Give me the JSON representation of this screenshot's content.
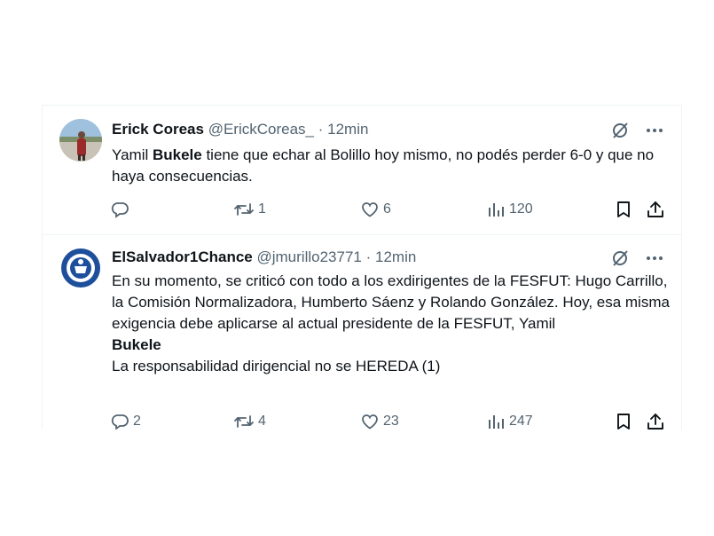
{
  "tweets": [
    {
      "author_name": "Erick Coreas",
      "handle": "@ErickCoreas_",
      "separator": "·",
      "time": "12min",
      "text_parts": [
        "Yamil ",
        "Bukele",
        " tiene que echar al Bolillo hoy mismo, no podés perder 6-0 y que no haya consecuencias."
      ],
      "replies": "",
      "retweets": "1",
      "likes": "6",
      "views": "120"
    },
    {
      "author_name": "ElSalvador1Chance",
      "handle": "@jmurillo23771",
      "separator": "·",
      "time": "12min",
      "text_line1": "En su momento, se criticó con todo a los exdirigentes de la FESFUT: Hugo Carrillo, la Comisión Normalizadora, Humberto Sáenz y Rolando González. Hoy, esa misma exigencia debe aplicarse al actual presidente de la FESFUT, Yamil",
      "text_bold": "Bukele",
      "text_line3": "La responsabilidad dirigencial no se HEREDA (1)",
      "replies": "2",
      "retweets": "4",
      "likes": "23",
      "views": "247"
    }
  ],
  "icons": {
    "grok": "grok-icon",
    "more": "more-icon",
    "reply": "reply-icon",
    "retweet": "retweet-icon",
    "like": "like-icon",
    "views": "views-icon",
    "bookmark": "bookmark-icon",
    "share": "share-icon"
  },
  "colors": {
    "text": "#0f1419",
    "secondary": "#536471",
    "border": "#eff3f4"
  }
}
